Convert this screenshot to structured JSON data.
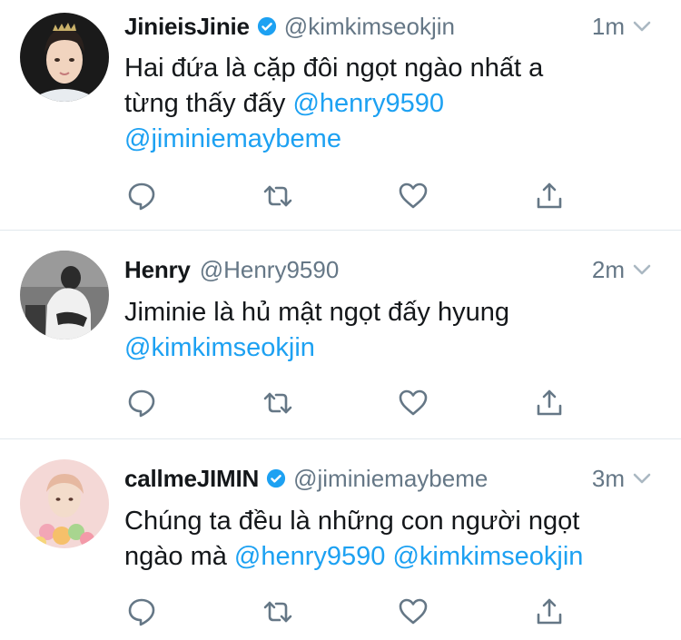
{
  "colors": {
    "mention": "#1da1f2",
    "secondary": "#657786",
    "divider": "#e1e8ed",
    "verified": "#1da1f2"
  },
  "tweets": [
    {
      "name": "JinieisJinie",
      "verified": true,
      "handle": "@kimkimseokjin",
      "time": "1m",
      "text_parts": [
        "Hai đứa là cặp đôi ngọt ngào nhất a",
        "từng thấy đấy ",
        "@henry9590",
        "@jiminiemaybeme"
      ]
    },
    {
      "name": "Henry",
      "verified": false,
      "handle": "@Henry9590",
      "time": "2m",
      "text_parts": [
        "Jiminie là hủ mật ngọt đấy hyung",
        "@kimkimseokjin"
      ]
    },
    {
      "name": "callmeJIMIN",
      "verified": true,
      "handle": "@jiminiemaybeme",
      "time": "3m",
      "text_parts": [
        "Chúng ta đều là những con người ngọt",
        "ngào mà ",
        "@henry9590",
        " ",
        "@kimkimseokjin"
      ]
    }
  ],
  "icons": [
    "reply-icon",
    "retweet-icon",
    "like-icon",
    "share-icon",
    "verified-badge-icon",
    "chevron-down-icon"
  ]
}
